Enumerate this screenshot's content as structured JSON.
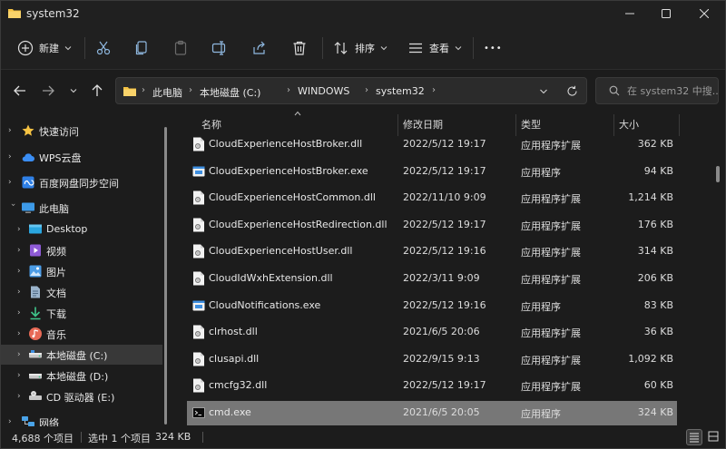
{
  "window": {
    "title": "system32"
  },
  "toolbar": {
    "new_label": "新建",
    "sort_label": "排序",
    "view_label": "查看",
    "more_label": "•••"
  },
  "address": {
    "crumbs": [
      "此电脑",
      "本地磁盘 (C:)",
      "WINDOWS",
      "system32"
    ],
    "search_placeholder": "在 system32 中搜..."
  },
  "sidebar": {
    "items": [
      {
        "label": "快速访问",
        "icon": "star-icon"
      },
      {
        "label": "WPS云盘",
        "icon": "cloud-icon"
      },
      {
        "label": "百度网盘同步空间",
        "icon": "baidu-netdisk-icon"
      },
      {
        "label": "此电脑",
        "icon": "computer-icon"
      },
      {
        "label": "Desktop",
        "icon": "desktop-icon"
      },
      {
        "label": "视频",
        "icon": "video-icon"
      },
      {
        "label": "图片",
        "icon": "picture-icon"
      },
      {
        "label": "文档",
        "icon": "document-icon"
      },
      {
        "label": "下载",
        "icon": "download-icon"
      },
      {
        "label": "音乐",
        "icon": "music-icon"
      },
      {
        "label": "本地磁盘 (C:)",
        "icon": "drive-icon"
      },
      {
        "label": "本地磁盘 (D:)",
        "icon": "drive-icon"
      },
      {
        "label": "CD 驱动器 (E:)",
        "icon": "cd-drive-icon"
      },
      {
        "label": "网络",
        "icon": "network-icon"
      }
    ]
  },
  "columns": {
    "name": "名称",
    "date": "修改日期",
    "type": "类型",
    "size": "大小"
  },
  "files": [
    {
      "name": "CloudExperienceHostBroker.dll",
      "date": "2022/5/12 19:17",
      "type": "应用程序扩展",
      "size": "362 KB",
      "icon": "dll-file-icon"
    },
    {
      "name": "CloudExperienceHostBroker.exe",
      "date": "2022/5/12 19:17",
      "type": "应用程序",
      "size": "94 KB",
      "icon": "exe-file-icon"
    },
    {
      "name": "CloudExperienceHostCommon.dll",
      "date": "2022/11/10 9:09",
      "type": "应用程序扩展",
      "size": "1,214 KB",
      "icon": "dll-file-icon"
    },
    {
      "name": "CloudExperienceHostRedirection.dll",
      "date": "2022/5/12 19:17",
      "type": "应用程序扩展",
      "size": "176 KB",
      "icon": "dll-file-icon"
    },
    {
      "name": "CloudExperienceHostUser.dll",
      "date": "2022/5/12 19:16",
      "type": "应用程序扩展",
      "size": "314 KB",
      "icon": "dll-file-icon"
    },
    {
      "name": "CloudIdWxhExtension.dll",
      "date": "2022/3/11 9:09",
      "type": "应用程序扩展",
      "size": "206 KB",
      "icon": "dll-file-icon"
    },
    {
      "name": "CloudNotifications.exe",
      "date": "2022/5/12 19:16",
      "type": "应用程序",
      "size": "83 KB",
      "icon": "exe-file-icon"
    },
    {
      "name": "clrhost.dll",
      "date": "2021/6/5 20:06",
      "type": "应用程序扩展",
      "size": "36 KB",
      "icon": "dll-file-icon"
    },
    {
      "name": "clusapi.dll",
      "date": "2022/9/15 9:13",
      "type": "应用程序扩展",
      "size": "1,092 KB",
      "icon": "dll-file-icon"
    },
    {
      "name": "cmcfg32.dll",
      "date": "2022/5/12 19:17",
      "type": "应用程序扩展",
      "size": "60 KB",
      "icon": "dll-file-icon"
    },
    {
      "name": "cmd.exe",
      "date": "2021/6/5 20:05",
      "type": "应用程序",
      "size": "324 KB",
      "icon": "cmd-file-icon"
    }
  ],
  "status": {
    "item_count": "4,688 个项目",
    "selected": "选中 1 个项目",
    "selected_size": "324 KB"
  },
  "colors": {
    "background": "#1c1c1c",
    "selected_row": "#777777",
    "accent": "#4cc2ff",
    "folder": "#f6c343"
  }
}
